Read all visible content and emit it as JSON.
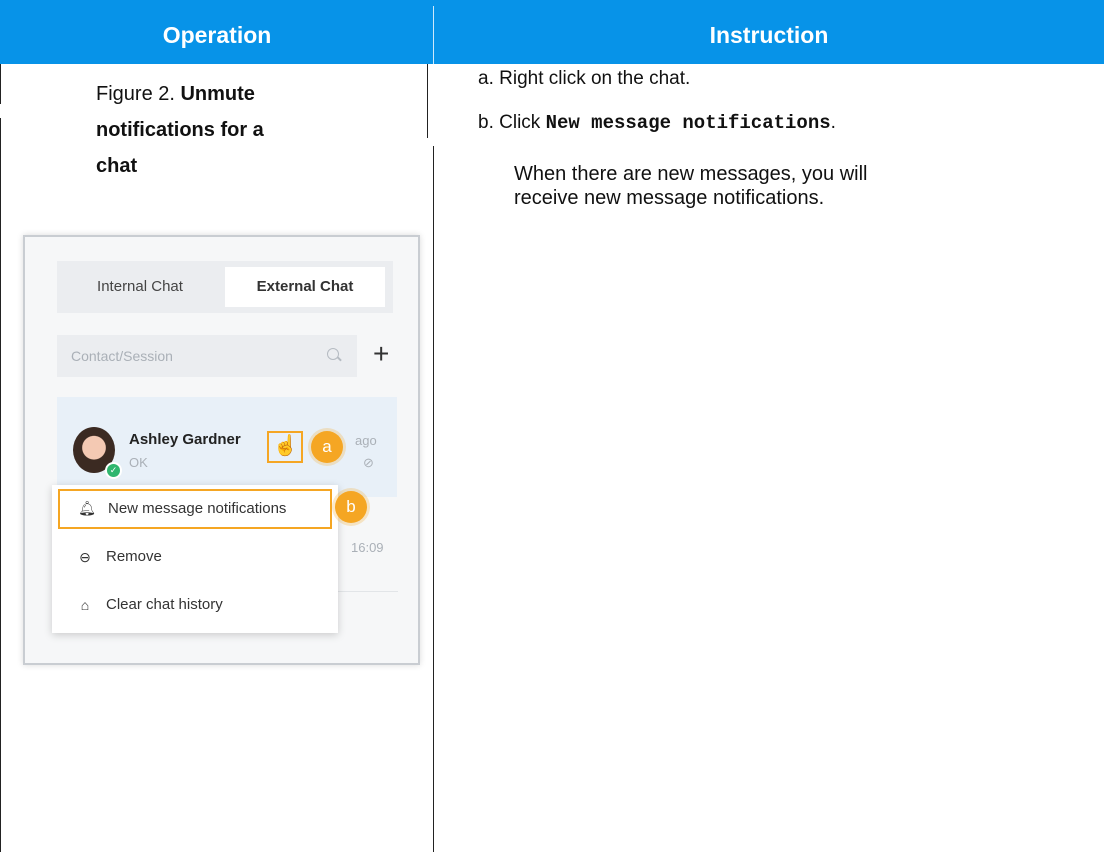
{
  "table": {
    "header": {
      "operation": "Operation",
      "instruction": "Instruction"
    }
  },
  "figure": {
    "prefix": "Figure 2. ",
    "title_line1": "Unmute",
    "title_line2": "notifications for a",
    "title_line3": "chat"
  },
  "steps": {
    "a": "a. Right click on the chat.",
    "b_prefix": "b. Click ",
    "b_code": "New message notifications",
    "b_suffix": ".",
    "note": "When there are new messages, you will receive new message notifications."
  },
  "screenshot": {
    "tabs": {
      "internal": "Internal Chat",
      "external": "External Chat"
    },
    "search": {
      "placeholder": "Contact/Session",
      "plus": "+"
    },
    "chat": {
      "name": "Ashley Gardner",
      "message": "OK",
      "time": "ago",
      "other_time": "16:09"
    },
    "callouts": {
      "a": "a",
      "b": "b"
    },
    "menu": {
      "items": [
        {
          "label": "New message notifications",
          "icon": "bell-icon"
        },
        {
          "label": "Remove",
          "icon": "minus-circle-icon"
        },
        {
          "label": "Clear chat history",
          "icon": "broom-icon"
        }
      ]
    },
    "colors": {
      "highlight": "#f5a623",
      "header": "#0793E8"
    }
  }
}
